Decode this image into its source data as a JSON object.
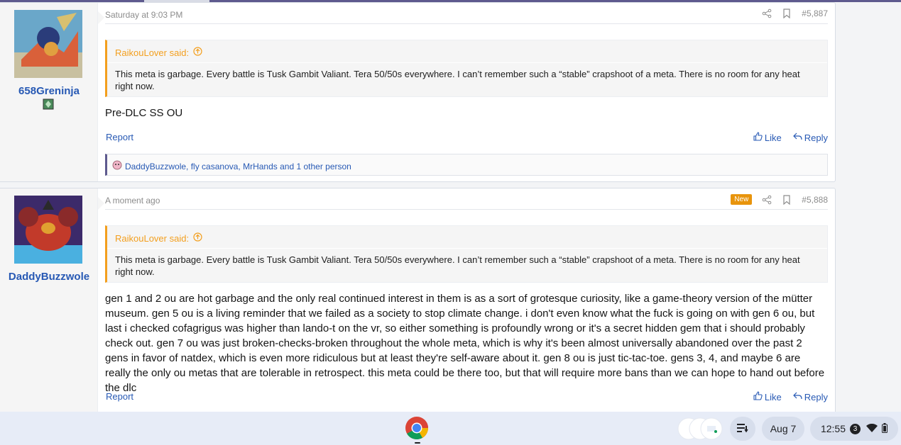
{
  "posts": [
    {
      "username": "658Greninja",
      "date": "Saturday at 9:03 PM",
      "post_number": "#5,887",
      "quote_author": "RaikouLover said:",
      "quote_text": "This meta is garbage. Every battle is Tusk Gambit Valiant. Tera 50/50s everywhere. I can’t remember such a “stable” crapshoot of a meta. There is no room for any heat right now.",
      "body": "Pre-DLC SS OU",
      "report_label": "Report",
      "like_label": "Like",
      "reply_label": "Reply",
      "reactions_text": "DaddyBuzzwole, fly casanova, MrHands and 1 other person"
    },
    {
      "username": "DaddyBuzzwole",
      "date": "A moment ago",
      "new_badge": "New",
      "post_number": "#5,888",
      "quote_author": "RaikouLover said:",
      "quote_text": "This meta is garbage. Every battle is Tusk Gambit Valiant. Tera 50/50s everywhere. I can’t remember such a “stable” crapshoot of a meta. There is no room for any heat right now.",
      "body": "gen 1 and 2 ou are hot garbage and the only real continued interest in them is as a sort of grotesque curiosity, like a game-theory version of the mütter museum. gen 5 ou is a living reminder that we failed as a society to stop climate change. i don't even know what the fuck is going on with gen 6 ou, but last i checked cofagrigus was higher than lando-t on the vr, so either something is profoundly wrong or it's a secret hidden gem that i should probably check out. gen 7 ou was just broken-checks-broken throughout the whole meta, which is why it's been almost universally abandoned over the past 2 gens in favor of natdex, which is even more ridiculous but at least they're self-aware about it. gen 8 ou is just tic-tac-toe. gens 3, 4, and maybe 6 are really the only ou metas that are tolerable in retrospect. this meta could be there too, but that will require more bans than we can hope to hand out before the dlc",
      "report_label": "Report",
      "like_label": "Like",
      "reply_label": "Reply"
    }
  ],
  "shelf": {
    "date": "Aug 7",
    "time": "12:55",
    "notification_count": "3"
  },
  "colors": {
    "link": "#2759b4",
    "quote_accent": "#f39f1e",
    "new_badge": "#e8940c",
    "shelf_bg": "#e7ecf7"
  }
}
